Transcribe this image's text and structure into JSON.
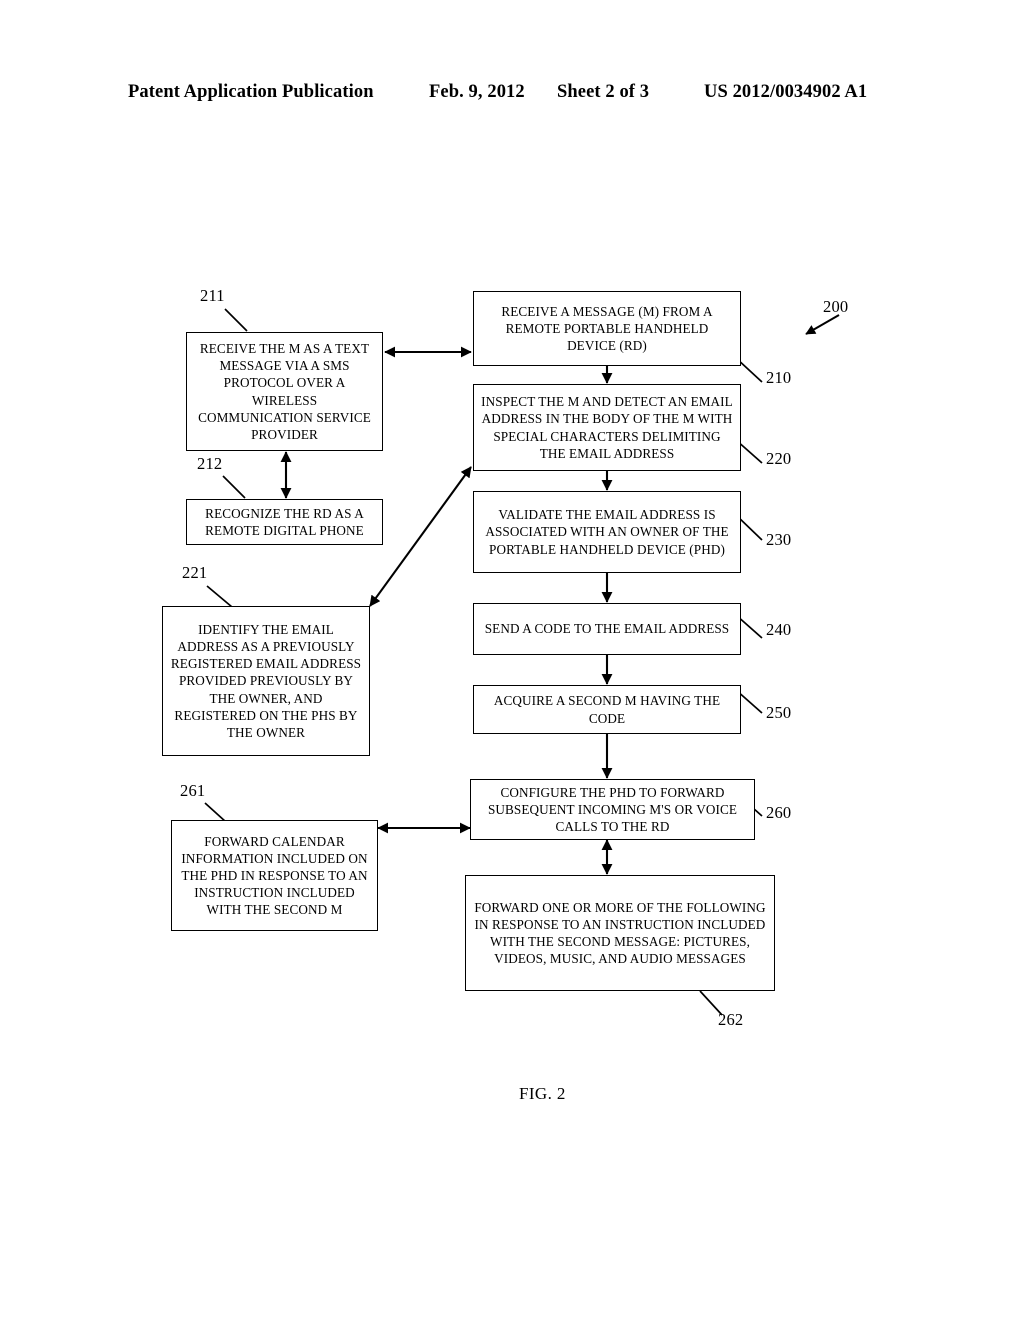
{
  "header": {
    "publication": "Patent Application Publication",
    "date": "Feb. 9, 2012",
    "sheet": "Sheet 2 of 3",
    "patent_number": "US 2012/0034902 A1"
  },
  "figure": {
    "caption": "FIG. 2",
    "diagram_label": "200",
    "boxes": [
      {
        "id": "210",
        "ref": "210",
        "text": "RECEIVE A MESSAGE (M) FROM A REMOTE PORTABLE HANDHELD DEVICE (RD)"
      },
      {
        "id": "220",
        "ref": "220",
        "text": "INSPECT THE M AND DETECT AN EMAIL ADDRESS IN THE BODY OF THE M WITH SPECIAL CHARACTERS DELIMITING THE EMAIL ADDRESS"
      },
      {
        "id": "230",
        "ref": "230",
        "text": "VALIDATE THE EMAIL ADDRESS IS ASSOCIATED WITH AN OWNER OF THE PORTABLE HANDHELD DEVICE (PHD)"
      },
      {
        "id": "240",
        "ref": "240",
        "text": "SEND A CODE TO THE EMAIL ADDRESS"
      },
      {
        "id": "250",
        "ref": "250",
        "text": "ACQUIRE A SECOND M HAVING THE CODE"
      },
      {
        "id": "260",
        "ref": "260",
        "text": "CONFIGURE THE PHD TO FORWARD SUBSEQUENT INCOMING M'S OR VOICE CALLS TO THE RD"
      },
      {
        "id": "262",
        "ref": "262",
        "text": "FORWARD ONE OR MORE OF THE FOLLOWING IN RESPONSE TO AN INSTRUCTION INCLUDED WITH THE SECOND MESSAGE: PICTURES, VIDEOS, MUSIC, AND AUDIO MESSAGES"
      },
      {
        "id": "211",
        "ref": "211",
        "text": "RECEIVE THE M AS A TEXT MESSAGE VIA A SMS PROTOCOL OVER A WIRELESS COMMUNICATION SERVICE PROVIDER"
      },
      {
        "id": "212",
        "ref": "212",
        "text": "RECOGNIZE THE RD AS A REMOTE DIGITAL PHONE"
      },
      {
        "id": "221",
        "ref": "221",
        "text": "IDENTIFY THE EMAIL ADDRESS AS A PREVIOUSLY REGISTERED EMAIL ADDRESS PROVIDED PREVIOUSLY BY THE OWNER, AND REGISTERED ON THE PHS BY THE OWNER"
      },
      {
        "id": "261",
        "ref": "261",
        "text": "FORWARD CALENDAR INFORMATION INCLUDED ON THE PHD IN RESPONSE TO AN INSTRUCTION INCLUDED WITH THE SECOND M"
      }
    ]
  },
  "colors": {
    "ink": "#000000",
    "paper": "#ffffff"
  }
}
